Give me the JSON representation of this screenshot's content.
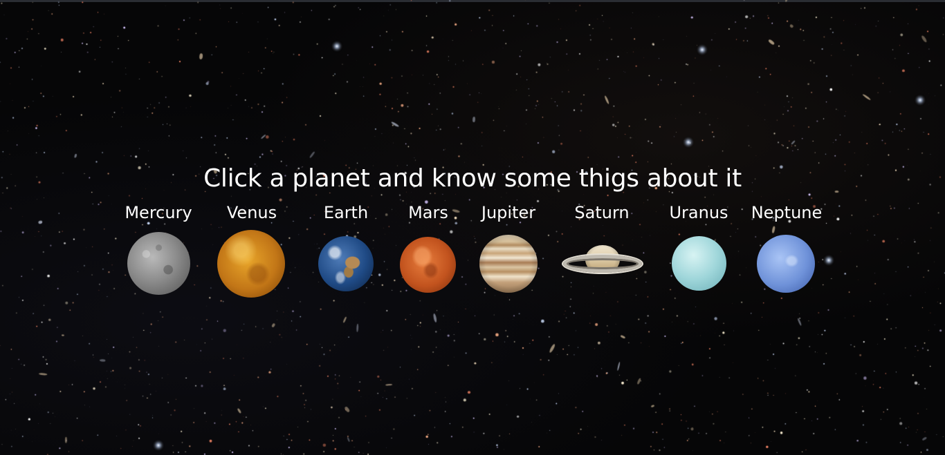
{
  "heading": "Click a planet and know some thigs about it",
  "planets": [
    {
      "label": "Mercury",
      "icon": "mercury-icon"
    },
    {
      "label": "Venus",
      "icon": "venus-icon"
    },
    {
      "label": "Earth",
      "icon": "earth-icon"
    },
    {
      "label": "Mars",
      "icon": "mars-icon"
    },
    {
      "label": "Jupiter",
      "icon": "jupiter-icon"
    },
    {
      "label": "Saturn",
      "icon": "saturn-icon"
    },
    {
      "label": "Uranus",
      "icon": "uranus-icon"
    },
    {
      "label": "Neptune",
      "icon": "neptune-icon"
    }
  ],
  "colors": {
    "background": "#060607",
    "text": "#ffffff"
  }
}
